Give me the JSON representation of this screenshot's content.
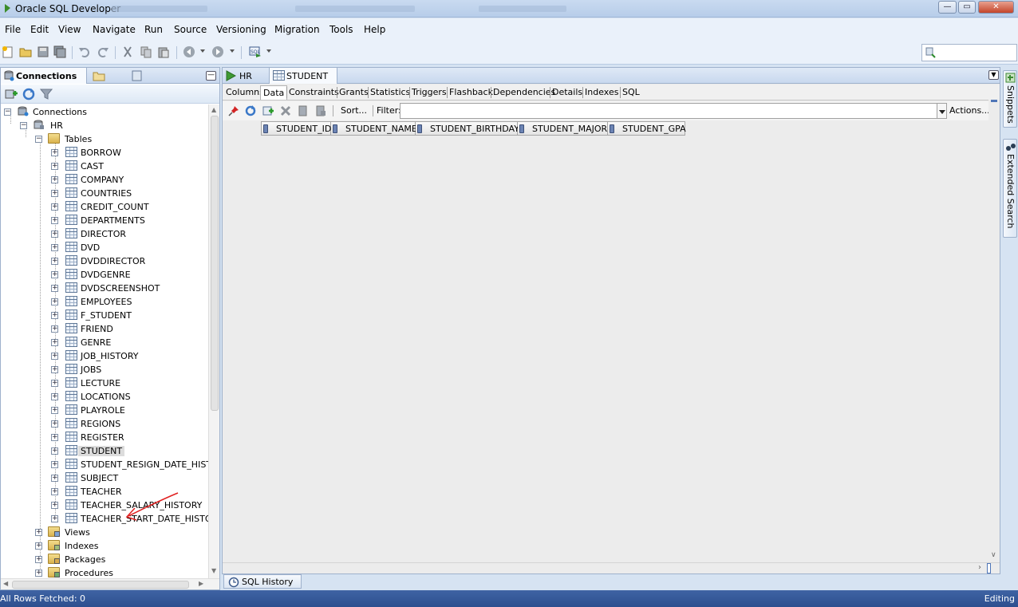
{
  "window": {
    "title": "Oracle SQL Developer"
  },
  "menu": [
    "File",
    "Edit",
    "View",
    "Navigate",
    "Run",
    "Source",
    "Versioning",
    "Migration",
    "Tools",
    "Help"
  ],
  "connections_panel": {
    "tab_label": "Connections",
    "tree": {
      "root": "Connections",
      "connection": "HR",
      "tables_folder": "Tables",
      "tables": [
        "BORROW",
        "CAST",
        "COMPANY",
        "COUNTRIES",
        "CREDIT_COUNT",
        "DEPARTMENTS",
        "DIRECTOR",
        "DVD",
        "DVDDIRECTOR",
        "DVDGENRE",
        "DVDSCREENSHOT",
        "EMPLOYEES",
        "F_STUDENT",
        "FRIEND",
        "GENRE",
        "JOB_HISTORY",
        "JOBS",
        "LECTURE",
        "LOCATIONS",
        "PLAYROLE",
        "REGIONS",
        "REGISTER",
        "STUDENT",
        "STUDENT_RESIGN_DATE_HISTOR",
        "SUBJECT",
        "TEACHER",
        "TEACHER_SALARY_HISTORY",
        "TEACHER_START_DATE_HISTOR"
      ],
      "selected_table": "STUDENT",
      "other_folders": [
        "Views",
        "Indexes",
        "Packages",
        "Procedures"
      ]
    }
  },
  "editor": {
    "tabs": [
      {
        "label": "HR",
        "icon": "run-worksheet-icon"
      },
      {
        "label": "STUDENT",
        "icon": "table-icon"
      }
    ],
    "active_tab": "STUDENT",
    "subtabs": [
      "Columns",
      "Data",
      "Constraints",
      "Grants",
      "Statistics",
      "Triggers",
      "Flashback",
      "Dependencies",
      "Details",
      "Indexes",
      "SQL"
    ],
    "active_subtab": "Data",
    "data_toolbar": {
      "sort_label": "Sort...",
      "filter_label": "Filter:",
      "filter_value": "",
      "actions_label": "Actions..."
    },
    "grid_columns": [
      "STUDENT_ID",
      "STUDENT_NAME",
      "STUDENT_BIRTHDAY",
      "STUDENT_MAJOR",
      "STUDENT_GPA"
    ]
  },
  "right_sidebar": {
    "tabs": [
      "Snippets",
      "Extended Search"
    ]
  },
  "bottom": {
    "sql_history_label": "SQL History"
  },
  "status": {
    "left": "All Rows Fetched: 0",
    "right": "Editing"
  },
  "colors": {
    "accent": "#2d4f8f",
    "annotation": "#e02020"
  }
}
